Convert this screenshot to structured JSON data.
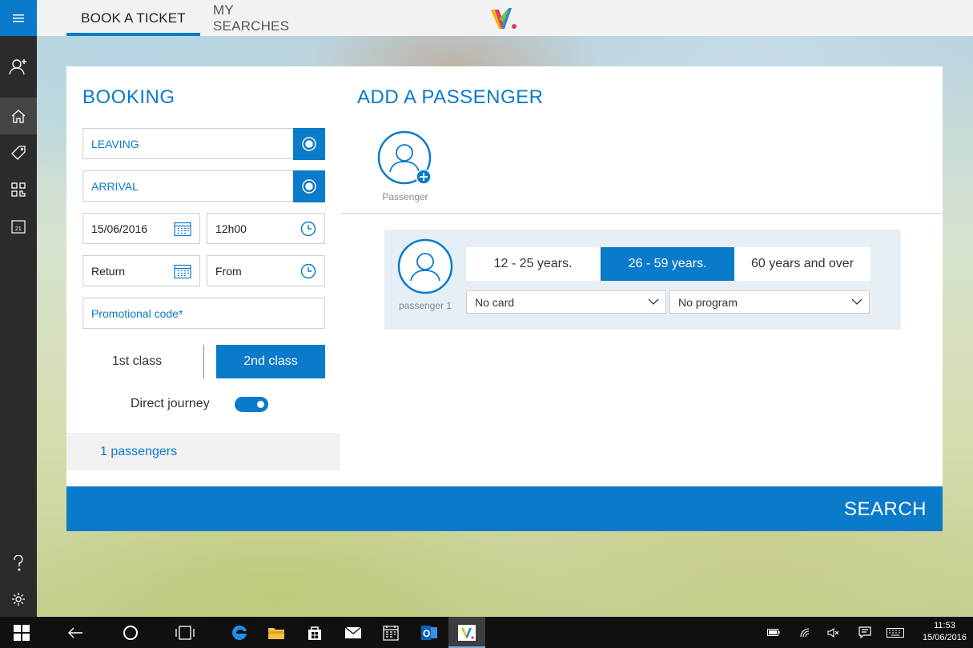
{
  "tabs": {
    "book": "BOOK A TICKET",
    "searches": "MY SEARCHES"
  },
  "booking": {
    "title": "BOOKING",
    "leaving": "LEAVING",
    "arrival": "ARRIVAL",
    "date": "15/06/2016",
    "time": "12h00",
    "return": "Return",
    "return_time": "From",
    "promo_placeholder": "Promotional code*",
    "class_first": "1st class",
    "class_second": "2nd class",
    "selected_class": "2nd class",
    "direct_journey_label": "Direct journey",
    "direct_journey_on": true,
    "passengers_summary": "1 passengers"
  },
  "add_passenger": {
    "title": "ADD A PASSENGER",
    "new_label": "Passenger",
    "passenger": {
      "label": "passenger 1",
      "ages": [
        "12 - 25 years.",
        "26 - 59 years.",
        "60 years and over"
      ],
      "selected_age": "26 - 59 years.",
      "card": "No card",
      "program": "No program"
    }
  },
  "search_label": "SEARCH",
  "taskbar": {
    "time": "11:53",
    "date": "15/06/2016"
  },
  "colors": {
    "accent": "#0a7acb",
    "rail": "#2b2b2b",
    "panel": "#e6eff6"
  },
  "icons": [
    "hamburger-icon",
    "add-user-icon",
    "home-icon",
    "tag-icon",
    "qr-code-icon",
    "calendar-icon",
    "help-icon",
    "settings-icon",
    "target-icon",
    "clock-icon",
    "user-icon",
    "chevron-down-icon"
  ]
}
